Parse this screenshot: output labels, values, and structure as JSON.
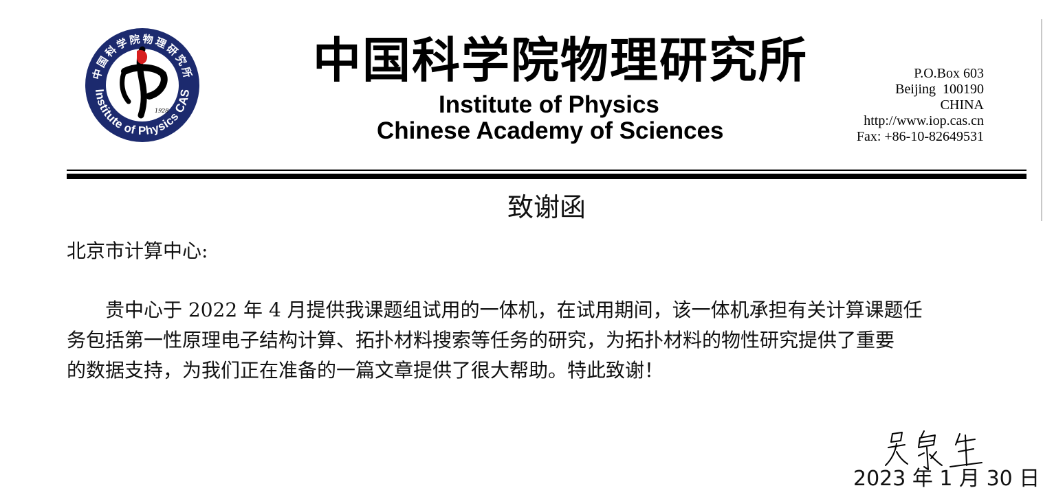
{
  "letterhead": {
    "logo": {
      "ring_text_cn": "中国科学院物理研究所",
      "ring_text_en": "Institute of Physics CAS",
      "year": "1928",
      "colors": {
        "ring": "#1c2a6e",
        "accent": "#d81e1e",
        "ink": "#000000"
      }
    },
    "org_name_cn": "中国科学院物理研究所",
    "org_name_en_line1": "Institute of Physics",
    "org_name_en_line2": "Chinese Academy of Sciences",
    "contact": {
      "po_box": "P.O.Box 603",
      "city_zip": "Beijing  100190",
      "country": "CHINA",
      "website": "http://www.iop.cas.cn",
      "fax": "Fax: +86-10-82649531"
    }
  },
  "letter": {
    "title": "致谢函",
    "salutation": "北京市计算中心:",
    "body_lines": [
      "贵中心于 2022 年 4 月提供我课题组试用的一体机，在试用期间，该一体机承担有关计算课题任",
      "务包括第一性原理电子结构计算、拓扑材料搜索等任务的研究，为拓扑材料的物性研究提供了重要",
      "的数据支持，为我们正在准备的一篇文章提供了很大帮助。特此致谢！"
    ],
    "signature_text": "吴泉生",
    "date": "2023 年 1 月 30 日"
  }
}
